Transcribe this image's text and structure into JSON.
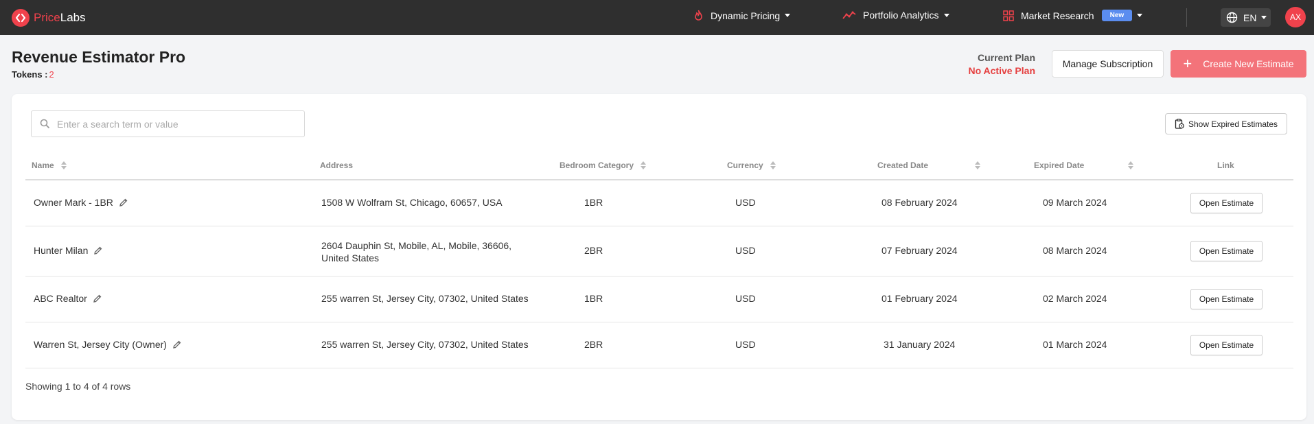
{
  "brand": {
    "name_part1": "Price",
    "name_part2": "Labs",
    "accent": "#f0424c"
  },
  "nav": {
    "dynamic_pricing": "Dynamic Pricing",
    "portfolio_analytics": "Portfolio Analytics",
    "market_research": "Market Research",
    "market_research_badge": "New",
    "language": "EN",
    "avatar_initials": "AX"
  },
  "header": {
    "title": "Revenue Estimator Pro",
    "tokens_label": "Tokens :",
    "tokens_value": "2",
    "plan_label": "Current Plan",
    "plan_value": "No Active Plan",
    "manage_label": "Manage Subscription",
    "create_label": "Create New Estimate"
  },
  "toolbar": {
    "search_placeholder": "Enter a search term or value",
    "expired_label": "Show Expired Estimates"
  },
  "table": {
    "columns": {
      "name": "Name",
      "address": "Address",
      "bedroom": "Bedroom Category",
      "currency": "Currency",
      "created": "Created Date",
      "expired": "Expired Date",
      "link": "Link"
    },
    "rows": [
      {
        "name": "Owner Mark - 1BR",
        "address_l1": "1508 W Wolfram St, Chicago, 60657, USA",
        "address_l2": "",
        "bedroom": "1BR",
        "currency": "USD",
        "created": "08 February 2024",
        "expired": "09 March 2024",
        "link": "Open Estimate"
      },
      {
        "name": "Hunter Milan",
        "address_l1": "2604 Dauphin St, Mobile, AL, Mobile, 36606,",
        "address_l2": "United States",
        "bedroom": "2BR",
        "currency": "USD",
        "created": "07 February 2024",
        "expired": "08 March 2024",
        "link": "Open Estimate"
      },
      {
        "name": "ABC Realtor",
        "address_l1": "255 warren St, Jersey City, 07302, United States",
        "address_l2": "",
        "bedroom": "1BR",
        "currency": "USD",
        "created": "01 February 2024",
        "expired": "02 March 2024",
        "link": "Open Estimate"
      },
      {
        "name": "Warren St, Jersey City (Owner)",
        "address_l1": "255 warren St, Jersey City, 07302, United States",
        "address_l2": "",
        "bedroom": "2BR",
        "currency": "USD",
        "created": "31 January 2024",
        "expired": "01 March 2024",
        "link": "Open Estimate"
      }
    ],
    "footer": "Showing 1 to 4 of 4 rows"
  }
}
